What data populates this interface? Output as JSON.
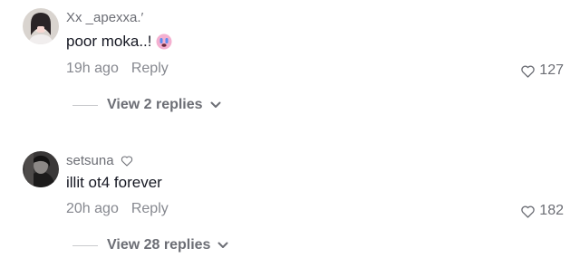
{
  "comments": [
    {
      "username": "Xx _apexxa.′",
      "text": "poor moka..!",
      "emoji_icon": "crying-face-icon",
      "time": "19h ago",
      "reply_label": "Reply",
      "likes": "127",
      "view_replies": "View 2 replies"
    },
    {
      "username": "setsuna",
      "username_icon": "heart-outline-icon",
      "text": "illit ot4 forever",
      "time": "20h ago",
      "reply_label": "Reply",
      "likes": "182",
      "view_replies": "View 28 replies"
    }
  ],
  "colors": {
    "text": "#161823",
    "secondary": "#86888f",
    "username": "#6c6e75"
  }
}
